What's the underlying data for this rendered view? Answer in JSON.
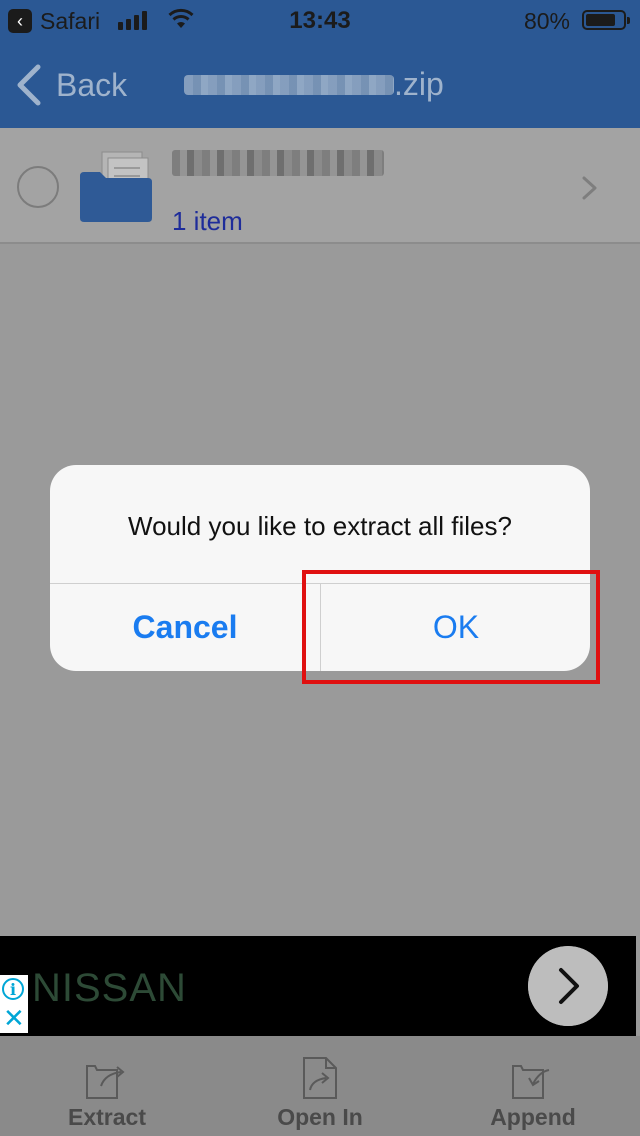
{
  "status_bar": {
    "app_back_label": "Safari",
    "time": "13:43",
    "battery_percent": "80%",
    "battery_level": 0.8
  },
  "nav": {
    "back_label": "Back",
    "title_suffix": ".zip"
  },
  "list": {
    "items": [
      {
        "count_label": "1 item"
      }
    ]
  },
  "alert": {
    "message": "Would you like to extract all files?",
    "cancel_label": "Cancel",
    "ok_label": "OK"
  },
  "ad": {
    "brand": "NISSAN",
    "info_icon": "info-icon",
    "close_icon": "close-icon"
  },
  "toolbar": {
    "extract_label": "Extract",
    "open_in_label": "Open In",
    "append_label": "Append"
  },
  "colors": {
    "nav_bar": "#2b5894",
    "accent": "#1a7cf0",
    "highlight": "#e01010"
  }
}
